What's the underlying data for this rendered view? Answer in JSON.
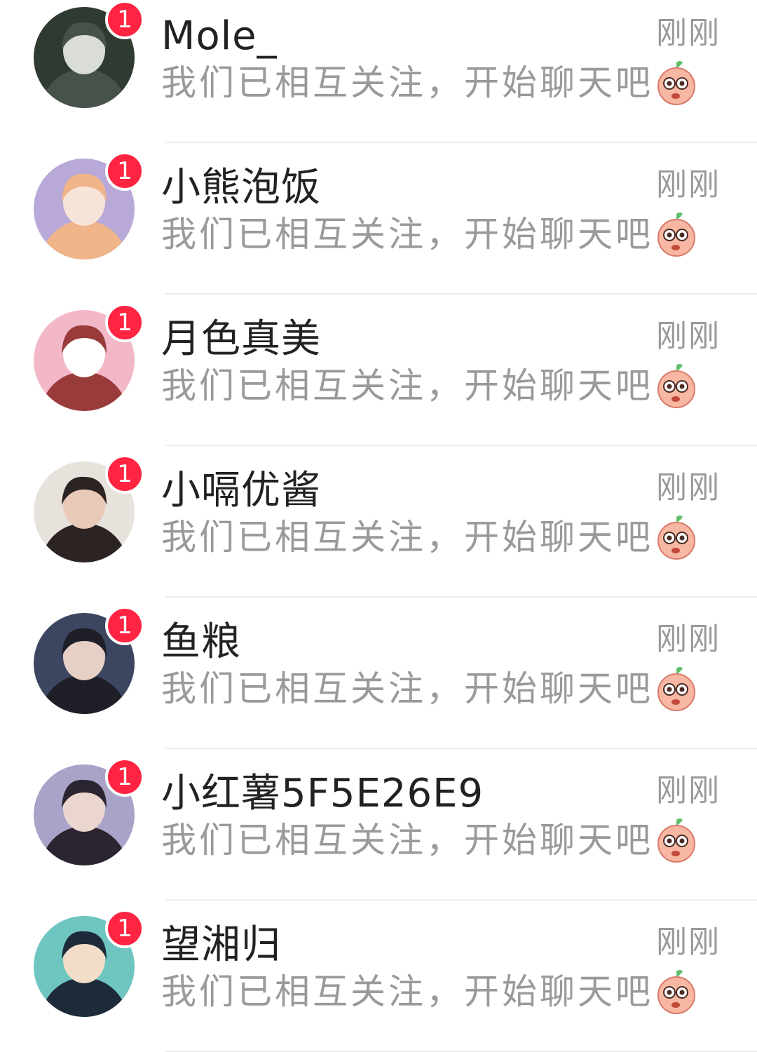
{
  "conversations": [
    {
      "name": "Mole_",
      "time": "刚刚",
      "preview": "我们已相互关注，开始聊天吧",
      "preview_emoji": "peach-face-emoji",
      "unread": "1",
      "avatar_colors": [
        "#2f3a30",
        "#46524a",
        "#d9ddd6"
      ]
    },
    {
      "name": "小熊泡饭",
      "time": "刚刚",
      "preview": "我们已相互关注，开始聊天吧",
      "preview_emoji": "peach-face-emoji",
      "unread": "1",
      "avatar_colors": [
        "#b8a9d8",
        "#f0b48a",
        "#f7e4d8"
      ]
    },
    {
      "name": "月色真美",
      "time": "刚刚",
      "preview": "我们已相互关注，开始聊天吧",
      "preview_emoji": "peach-face-emoji",
      "unread": "1",
      "avatar_colors": [
        "#f3b8c8",
        "#9a3b3b",
        "#ffffff"
      ]
    },
    {
      "name": "小嗝优酱",
      "time": "刚刚",
      "preview": "我们已相互关注，开始聊天吧",
      "preview_emoji": "peach-face-emoji",
      "unread": "1",
      "avatar_colors": [
        "#e8e2dc",
        "#2b2422",
        "#e9c9b8"
      ]
    },
    {
      "name": "鱼粮",
      "time": "刚刚",
      "preview": "我们已相互关注，开始聊天吧",
      "preview_emoji": "peach-face-emoji",
      "unread": "1",
      "avatar_colors": [
        "#3c4660",
        "#1f1f28",
        "#e6cfc4"
      ]
    },
    {
      "name": "小红薯5F5E26E9",
      "time": "刚刚",
      "preview": "我们已相互关注，开始聊天吧",
      "preview_emoji": "peach-face-emoji",
      "unread": "1",
      "avatar_colors": [
        "#a9a3c8",
        "#2a2530",
        "#ead6cf"
      ]
    },
    {
      "name": "望湘归",
      "time": "刚刚",
      "preview": "我们已相互关注，开始聊天吧",
      "preview_emoji": "peach-face-emoji",
      "unread": "1",
      "avatar_colors": [
        "#6fc6c0",
        "#1d2a3a",
        "#f1ddc8"
      ]
    }
  ],
  "colors": {
    "badge": "#ff2442",
    "name_text": "#222222",
    "secondary_text": "#9a9a9a",
    "divider": "#ececec"
  }
}
